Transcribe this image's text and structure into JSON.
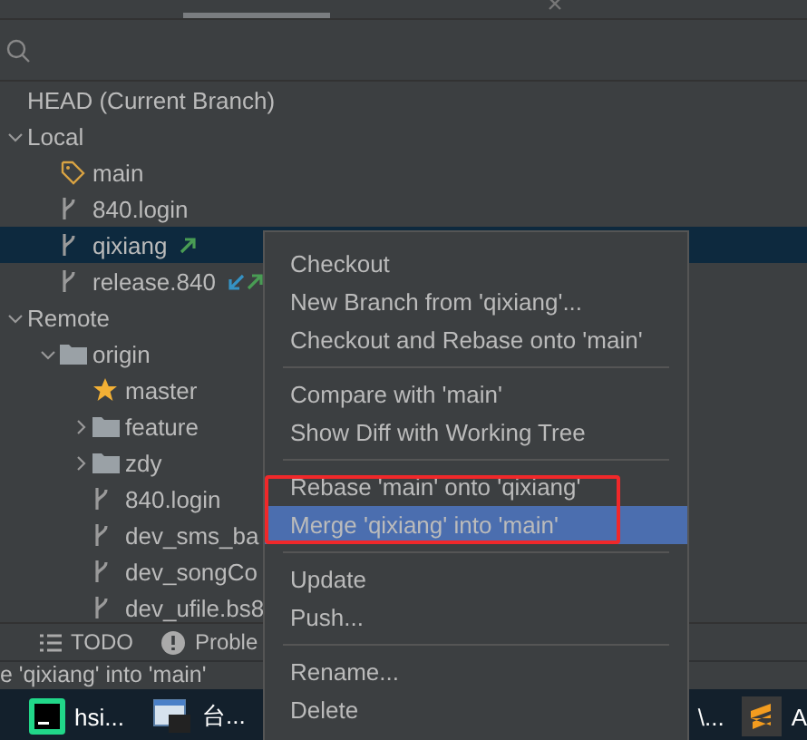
{
  "tabs": [
    {
      "selected": false
    },
    {
      "selected": true
    },
    {
      "selected": false,
      "closable": true
    },
    {
      "selected": false
    }
  ],
  "tree": [
    {
      "label": "HEAD (Current Branch)"
    },
    {
      "label": "Local",
      "expanded": true,
      "children": [
        {
          "label": "main",
          "kind": "tag"
        },
        {
          "label": "840.login",
          "kind": "branch"
        },
        {
          "label": "qixiang",
          "kind": "branch",
          "selected": true,
          "outgoing": true
        },
        {
          "label": "release.840",
          "kind": "branch",
          "incoming": true,
          "outgoing": true
        }
      ]
    },
    {
      "label": "Remote",
      "expanded": true,
      "children": [
        {
          "label": "origin",
          "kind": "folder",
          "expanded": true,
          "children": [
            {
              "label": "master",
              "kind": "favorite"
            },
            {
              "label": "feature",
              "kind": "folder",
              "expanded": false
            },
            {
              "label": "zdy",
              "kind": "folder",
              "expanded": false
            },
            {
              "label": "840.login",
              "kind": "branch"
            },
            {
              "label": "dev_sms_ba",
              "kind": "branch"
            },
            {
              "label": "dev_songCo",
              "kind": "branch"
            },
            {
              "label": "dev_ufile.bs8",
              "kind": "branch"
            }
          ]
        }
      ]
    }
  ],
  "tool_tabs": [
    {
      "label": "TODO",
      "kind": "list"
    },
    {
      "label": "Proble",
      "kind": "problems"
    }
  ],
  "status_bar": "e 'qixiang' into 'main'",
  "taskbar": [
    {
      "label": "hsi...",
      "kind": "clion"
    },
    {
      "label": "台...",
      "kind": "window"
    }
  ],
  "taskbar_right": [
    {
      "label": "\\...",
      "kind": "none"
    },
    {
      "label": "A",
      "kind": "sublime"
    }
  ],
  "context_menu": [
    [
      {
        "label": "Checkout",
        "selected": false
      },
      {
        "label": "New Branch from 'qixiang'...",
        "selected": false
      },
      {
        "label": "Checkout and Rebase onto 'main'",
        "selected": false
      }
    ],
    [
      {
        "label": "Compare with 'main'",
        "selected": false
      },
      {
        "label": "Show Diff with Working Tree",
        "selected": false
      }
    ],
    [
      {
        "label": "Rebase 'main' onto 'qixiang'",
        "selected": false
      },
      {
        "label": "Merge 'qixiang' into 'main'",
        "selected": true,
        "marked": true
      }
    ],
    [
      {
        "label": "Update",
        "selected": false
      },
      {
        "label": "Push...",
        "selected": false
      }
    ],
    [
      {
        "label": "Rename...",
        "selected": false
      },
      {
        "label": "Delete",
        "selected": false
      }
    ]
  ]
}
